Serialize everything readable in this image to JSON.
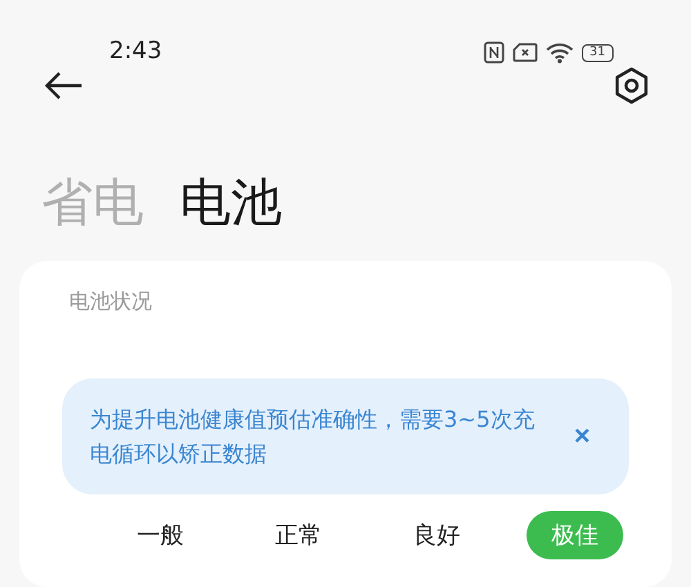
{
  "status_bar": {
    "time": "2:43",
    "battery": "31"
  },
  "tabs": [
    {
      "label": "省电",
      "selected": false
    },
    {
      "label": "电池",
      "selected": true
    }
  ],
  "card": {
    "title": "电池状况",
    "notice": {
      "text": "为提升电池健康值预估准确性，需要3~5次充电循环以矫正数据",
      "close": "×"
    },
    "grades": [
      {
        "label": "一般",
        "selected": false
      },
      {
        "label": "正常",
        "selected": false
      },
      {
        "label": "良好",
        "selected": false
      },
      {
        "label": "极佳",
        "selected": true
      }
    ]
  }
}
